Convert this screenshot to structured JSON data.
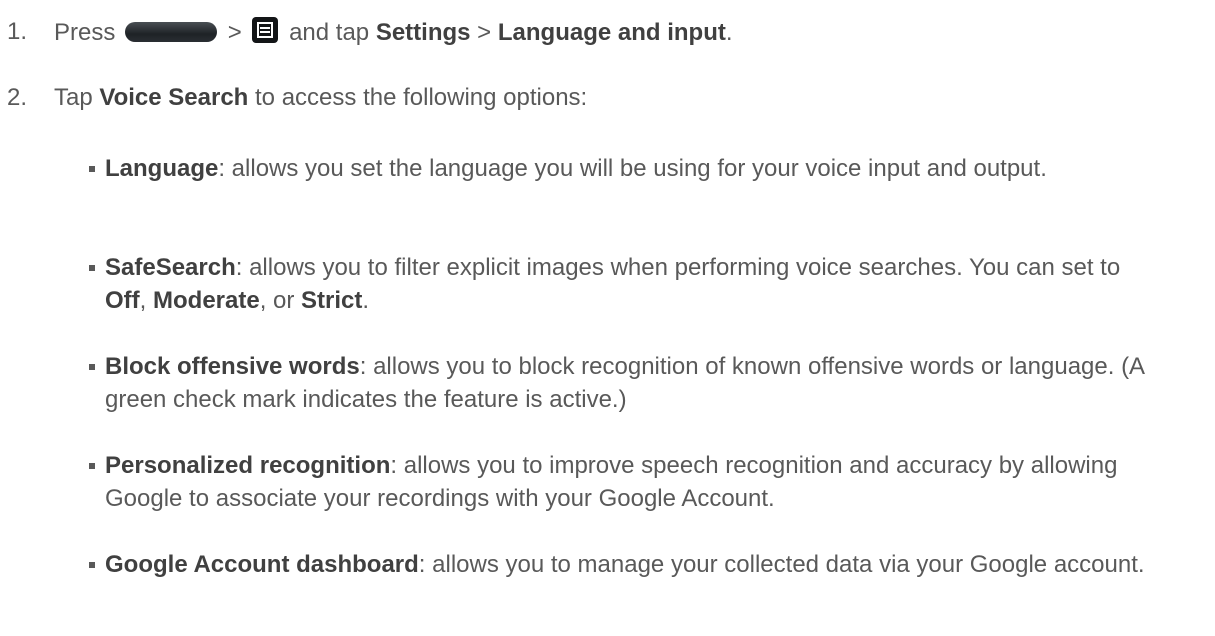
{
  "steps": [
    {
      "number": "1.",
      "press": "Press",
      "home_key_icon": "home-key-icon",
      "sep1": ">",
      "menu_key_icon": "menu-key-icon",
      "and_tap": "and tap",
      "settings": "Settings",
      "sep2": ">",
      "language_and_input": "Language and input",
      "end": "."
    },
    {
      "number": "2.",
      "tap": "Tap",
      "voice_search": "Voice Search",
      "rest": "to access the following options:"
    }
  ],
  "options": [
    {
      "term": "Language",
      "desc": ": allows you set the language you will be using for your voice input and output."
    },
    {
      "term": "SafeSearch",
      "desc": ": allows you to filter explicit images when performing voice searches. You can set to ",
      "values": [
        "Off",
        "Moderate",
        "Strict"
      ],
      "sep_a": ", ",
      "sep_b": ", or ",
      "end": "."
    },
    {
      "term": "Block offensive words",
      "desc": ": allows you to block recognition of known offensive words or language. (A green check mark indicates the feature is active.)"
    },
    {
      "term": "Personalized recognition",
      "desc": ": allows you to improve speech recognition and accuracy by allowing Google to associate your recordings with your Google Account."
    },
    {
      "term": "Google Account dashboard",
      "desc": ": allows you to manage your collected data via your Google account."
    }
  ]
}
